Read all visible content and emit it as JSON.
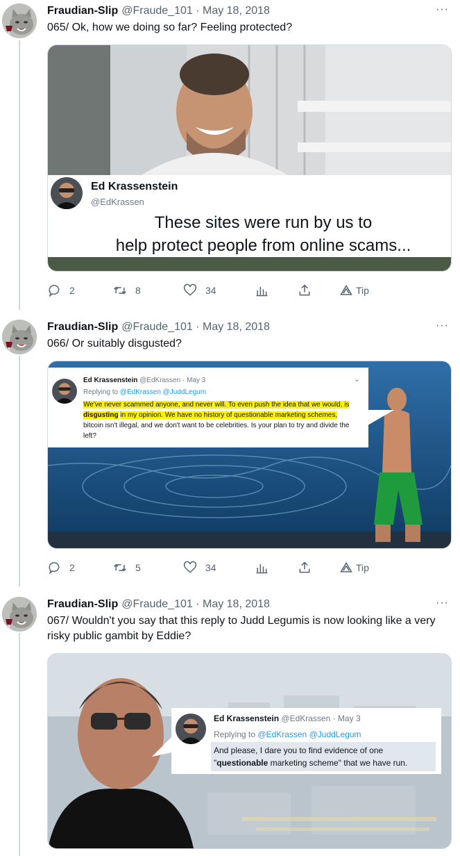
{
  "tweets": [
    {
      "author_name": "Fraudian-Slip",
      "author_meta": "@Fraude_101 · May 18, 2018",
      "more": "···",
      "text": "065/ Ok, how we doing so far? Feeling protected?",
      "embed": {
        "name": "Ed Krassenstein",
        "handle": "@EdKrassen",
        "quote_line1": "These sites were run by us to",
        "quote_line2": "help protect people from online scams..."
      },
      "replies": "2",
      "retweets": "8",
      "likes": "34",
      "tip": "Tip"
    },
    {
      "author_name": "Fraudian-Slip",
      "author_meta": "@Fraude_101 · May 18, 2018",
      "more": "···",
      "text": "066/ Or suitably disgusted?",
      "embed": {
        "name": "Ed Krassenstein",
        "meta": "@EdKrassen · May 3",
        "replying_prefix": "Replying to",
        "replying_to": "@EdKrassen @JuddLegum",
        "body_hl1": "We've never scammed anyone, and never will. To even push the idea that we would, is",
        "body_bold": "disgusting",
        "body_hl2": "in my opinion. We have no history of questionable marketing schemes,",
        "body_rest": " bitcoin isn't illegal, and we don't want to be celebrities. Is your plan to try and divide the left?"
      },
      "replies": "2",
      "retweets": "5",
      "likes": "34",
      "tip": "Tip"
    },
    {
      "author_name": "Fraudian-Slip",
      "author_meta": "@Fraude_101 · May 18, 2018",
      "more": "···",
      "text": "067/ Wouldn't you say that this reply to Judd Legumis is now looking like a very risky public gambit by Eddie?",
      "embed": {
        "name": "Ed Krassenstein",
        "meta": "@EdKrassen · May 3",
        "replying_prefix": "Replying to",
        "replying_to": "@EdKrassen @JuddLegum",
        "body_pre": "And please, I dare you to find evidence of one",
        "body_quote_open": "\"",
        "body_bold": "questionable",
        "body_post": " marketing scheme\" that we have run."
      }
    }
  ]
}
